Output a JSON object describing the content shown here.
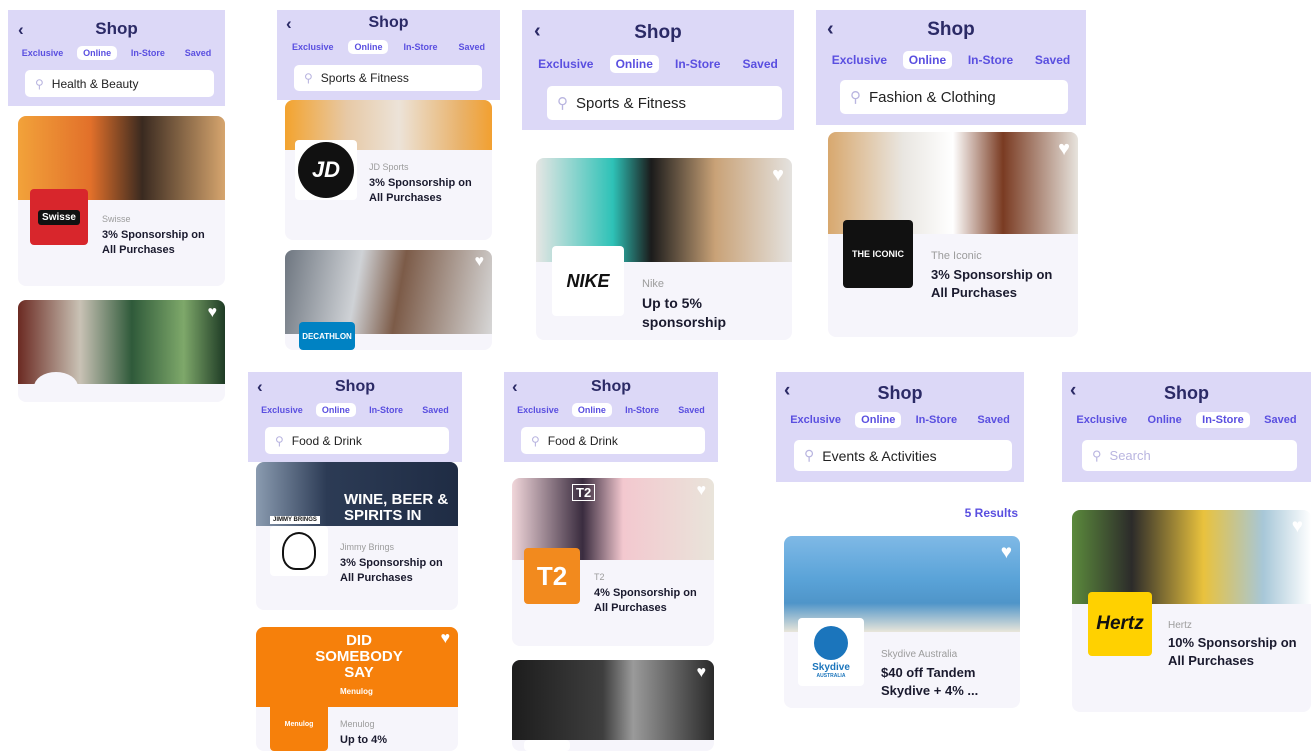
{
  "common": {
    "title": "Shop",
    "tabs": [
      "Exclusive",
      "Online",
      "In-Store",
      "Saved"
    ]
  },
  "screens": {
    "s1": {
      "search": "Health & Beauty",
      "active_tab": "Online",
      "cards": [
        {
          "brand": "Swisse",
          "offer": "3% Sponsorship on All Purchases",
          "logo_text": "Swisse"
        }
      ]
    },
    "s2": {
      "search": "Sports & Fitness",
      "active_tab": "Online",
      "cards": [
        {
          "brand": "JD Sports",
          "offer": "3% Sponsorship on All Purchases",
          "logo_text": "JD"
        },
        {
          "brand": "Decathlon",
          "logo_text": "DECATHLON"
        }
      ]
    },
    "s3": {
      "search": "Sports & Fitness",
      "active_tab": "Online",
      "cards": [
        {
          "brand": "Nike",
          "offer": "Up to 5% sponsorship",
          "logo_text": "NIKE"
        }
      ]
    },
    "s4": {
      "search": "Fashion & Clothing",
      "active_tab": "Online",
      "cards": [
        {
          "brand": "The Iconic",
          "offer": "3% Sponsorship on All Purchases",
          "logo_text": "THE ICONIC"
        }
      ]
    },
    "s5": {
      "search": "Food & Drink",
      "active_tab": "Online",
      "cards": [
        {
          "brand": "Jimmy Brings",
          "offer": "3% Sponsorship on All Purchases",
          "photo_text": "WINE, BEER & SPIRITS IN",
          "photo_tag": "JIMMY BRINGS"
        },
        {
          "brand": "Menulog",
          "offer": "Up to 4%",
          "photo_text": "DID SOMEBODY SAY",
          "photo_tag": "Menulog",
          "logo_text": "Menulog"
        }
      ]
    },
    "s6": {
      "search": "Food & Drink",
      "active_tab": "Online",
      "cards": [
        {
          "brand": "T2",
          "offer": "4% Sponsorship on All Purchases",
          "logo_text": "T2",
          "photo_text": "T2"
        }
      ]
    },
    "s7": {
      "search": "Events & Activities",
      "active_tab": "Online",
      "results": "5 Results",
      "cards": [
        {
          "brand": "Skydive Australia",
          "offer": "$40 off Tandem Skydive + 4% ...",
          "logo_text": "Skydive",
          "logo_sub": "AUSTRALIA"
        }
      ]
    },
    "s8": {
      "search_placeholder": "Search",
      "active_tab": "In-Store",
      "cards": [
        {
          "brand": "Hertz",
          "offer": "10% Sponsorship on All Purchases",
          "logo_text": "Hertz"
        }
      ]
    }
  },
  "colors": {
    "header_bg": "#dcd8f7",
    "accent": "#5a4fe0",
    "title": "#2b2a66",
    "swisse": "#d8262c",
    "t2": "#f28a1e",
    "hertz": "#ffd100",
    "menulog": "#f6800b",
    "skydive": "#1b75bc"
  },
  "icons": [
    "back-arrow-icon",
    "search-icon",
    "heart-icon"
  ]
}
